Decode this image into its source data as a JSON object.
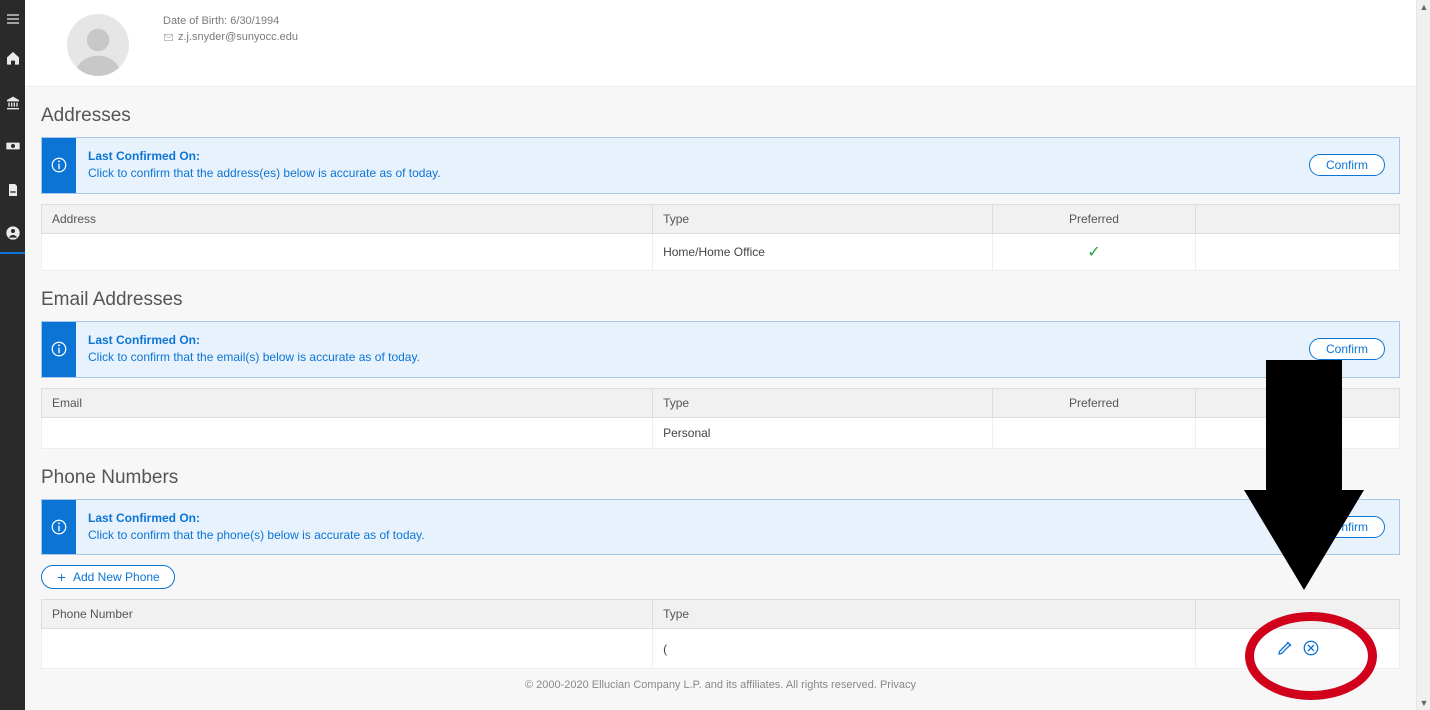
{
  "profile": {
    "dob_label": "Date of Birth:",
    "dob_value": "6/30/1994",
    "email": "z.j.snyder@sunyocc.edu"
  },
  "sections": {
    "addresses": {
      "title": "Addresses",
      "banner_title": "Last Confirmed On:",
      "banner_text": "Click to confirm that the address(es) below is accurate as of today.",
      "confirm_label": "Confirm",
      "headers": {
        "c1": "Address",
        "c2": "Type",
        "c3": "Preferred"
      },
      "rows": [
        {
          "address": "",
          "type": "Home/Home Office",
          "preferred": true
        }
      ]
    },
    "emails": {
      "title": "Email Addresses",
      "banner_title": "Last Confirmed On:",
      "banner_text": "Click to confirm that the email(s) below is accurate as of today.",
      "confirm_label": "Confirm",
      "headers": {
        "c1": "Email",
        "c2": "Type",
        "c3": "Preferred"
      },
      "rows": [
        {
          "email": "",
          "type": "Personal",
          "preferred": false
        }
      ]
    },
    "phones": {
      "title": "Phone Numbers",
      "banner_title": "Last Confirmed On:",
      "banner_text": "Click to confirm that the phone(s) below is accurate as of today.",
      "confirm_label": "Confirm",
      "add_label": "Add New Phone",
      "headers": {
        "c1": "Phone Number",
        "c2": "Type"
      },
      "rows": [
        {
          "phone": "",
          "type": "("
        }
      ]
    }
  },
  "footer": "© 2000-2020 Ellucian Company L.P. and its affiliates. All rights reserved. Privacy"
}
